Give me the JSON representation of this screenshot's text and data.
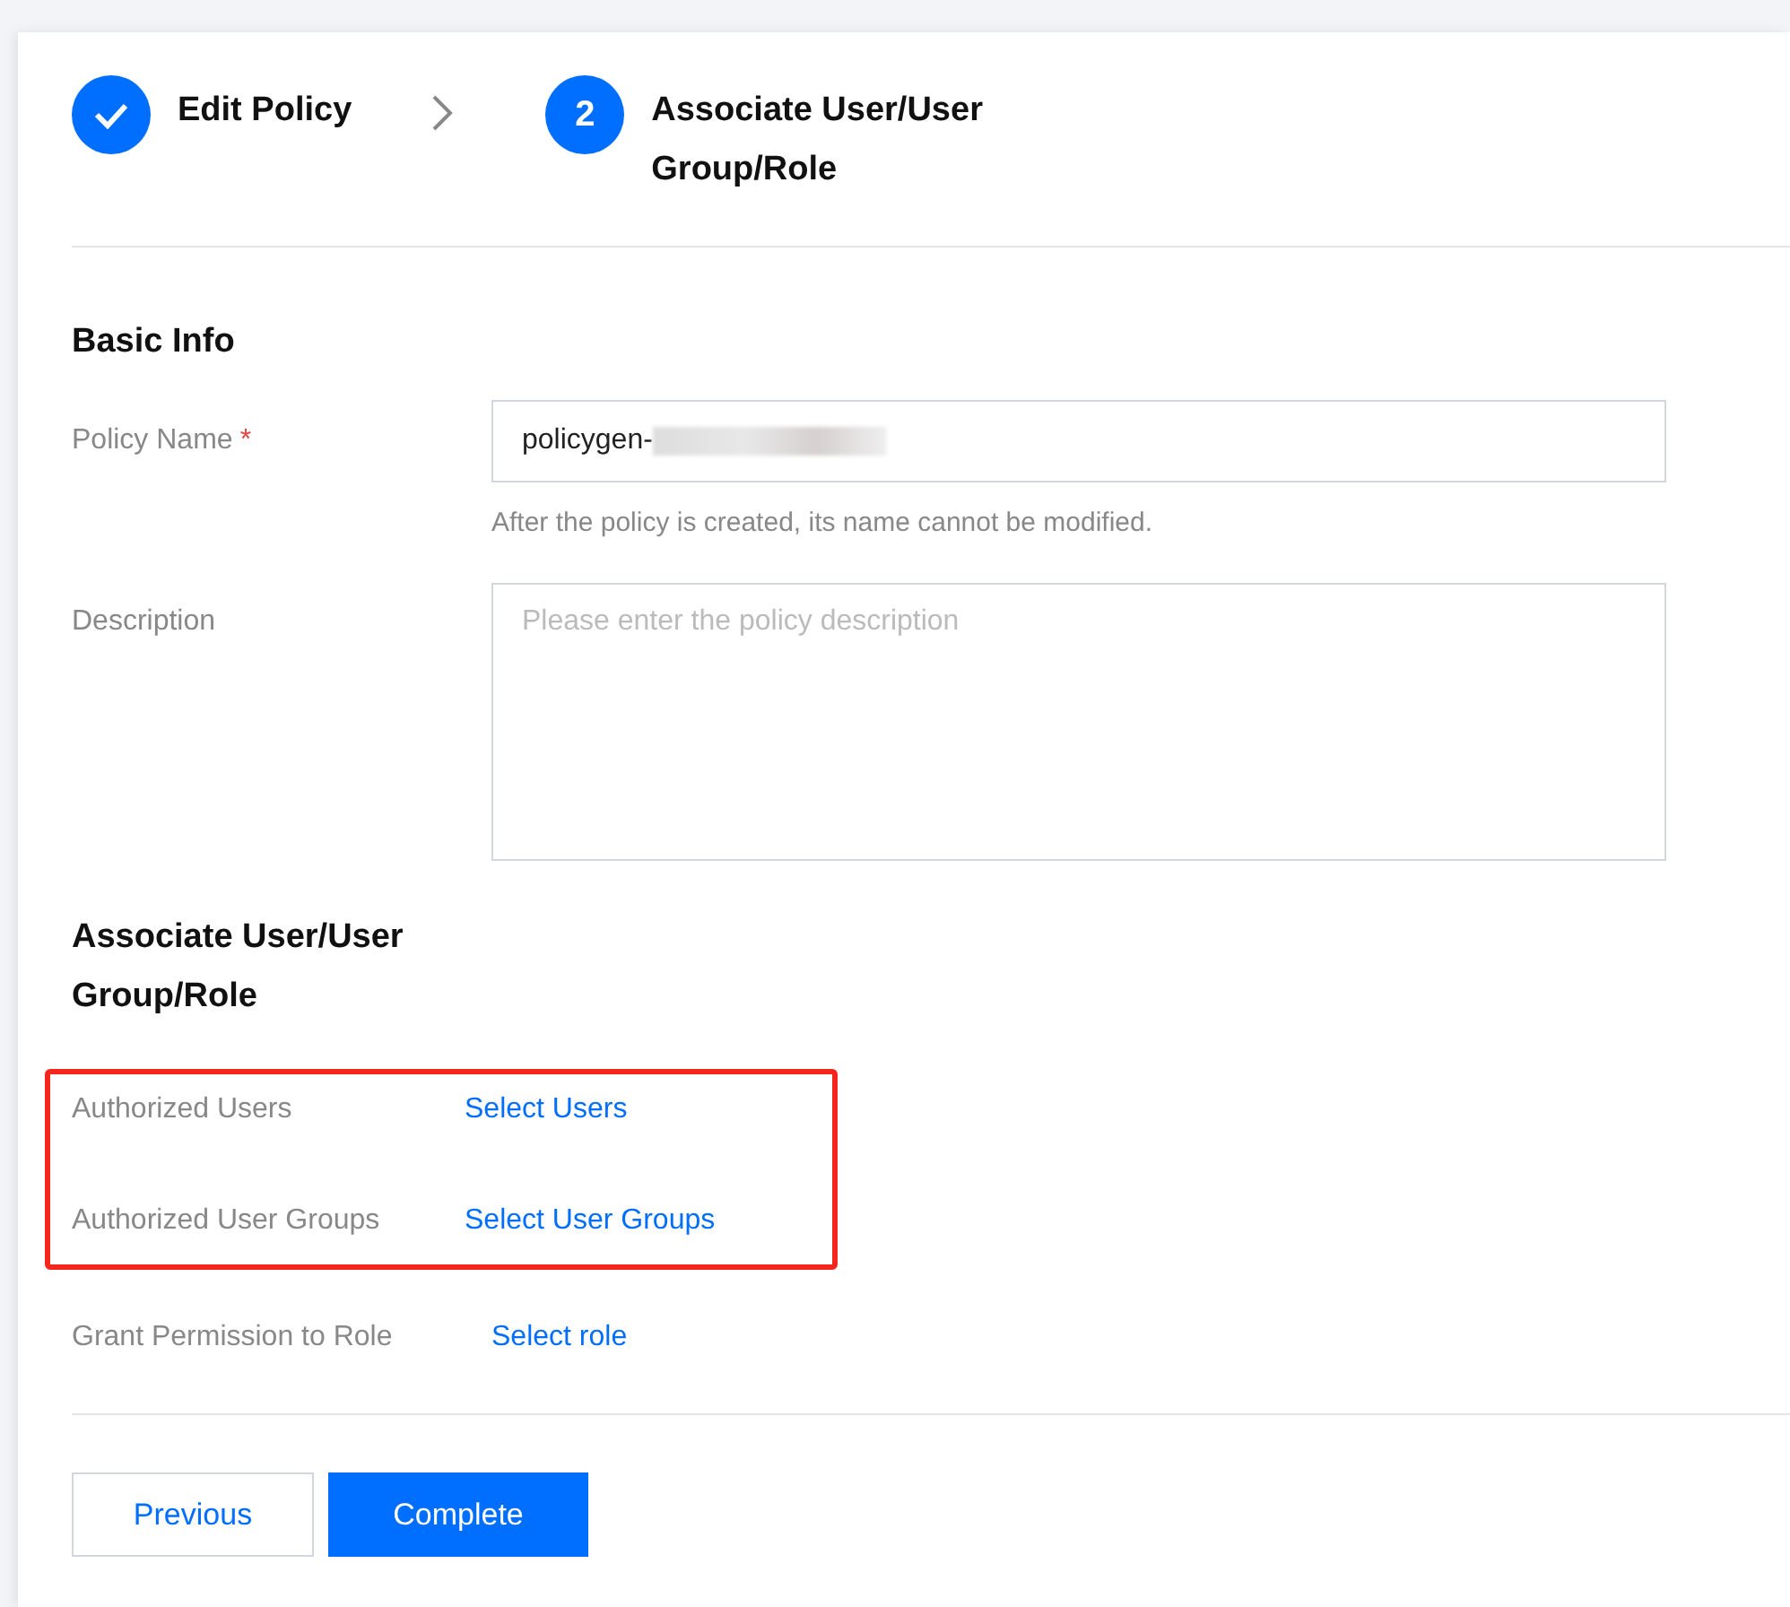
{
  "steps": [
    {
      "completed": true,
      "label": "Edit Policy"
    },
    {
      "completed": false,
      "number": "2",
      "label": "Associate User/User Group/Role"
    }
  ],
  "basic_info": {
    "title": "Basic Info",
    "policy_name": {
      "label": "Policy Name",
      "required_mark": "*",
      "value": "policygen-",
      "value_redacted": true,
      "hint": "After the policy is created, its name cannot be modified."
    },
    "description": {
      "label": "Description",
      "placeholder": "Please enter the policy description"
    }
  },
  "associate": {
    "title": "Associate User/User Group/Role",
    "highlighted_rows": [
      {
        "label": "Authorized Users",
        "link": "Select Users"
      },
      {
        "label": "Authorized User Groups",
        "link": "Select User Groups"
      }
    ],
    "rows": [
      {
        "label": "Grant Permission to Role",
        "link": "Select role"
      }
    ]
  },
  "buttons": [
    {
      "kind": "secondary",
      "label": "Previous"
    },
    {
      "kind": "primary",
      "label": "Complete"
    }
  ]
}
